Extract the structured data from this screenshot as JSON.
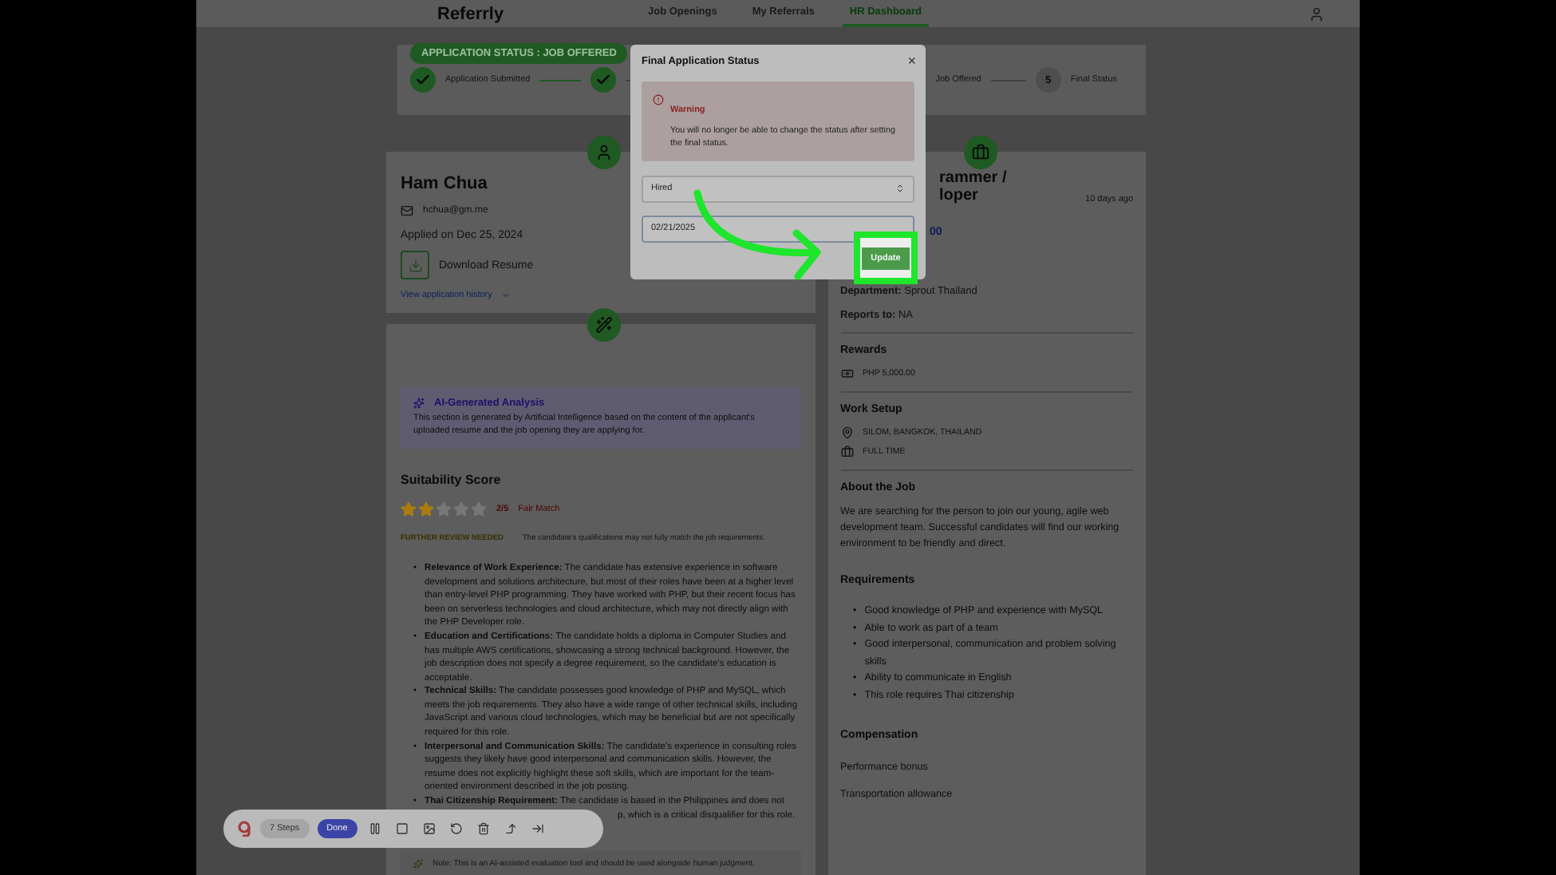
{
  "header": {
    "logo": "Referrly",
    "nav": [
      {
        "label": "Job Openings",
        "selected": false
      },
      {
        "label": "My Referrals",
        "selected": false
      },
      {
        "label": "HR Dashboard",
        "selected": true
      }
    ]
  },
  "status": {
    "badge": "APPLICATION STATUS : JOB OFFERED",
    "steps": [
      {
        "kind": "done",
        "label": "Application Submitted"
      },
      {
        "kind": "done"
      },
      {
        "kind": "text",
        "label": "Job Offered"
      },
      {
        "kind": "number",
        "number": "5",
        "label": "Final Status"
      }
    ]
  },
  "applicant": {
    "name": "Ham Chua",
    "email": "hchua@gm.me",
    "applied": "Applied on Dec 25, 2024",
    "download": "Download Resume",
    "history": "View application history"
  },
  "analysis": {
    "title": "AI-Generated Analysis",
    "description": "This section is generated by Artificial Intelligence based on the content of the applicant's uploaded resume and the job opening they are applying for.",
    "score_title": "Suitability Score",
    "stars": 2,
    "score": "2/5",
    "match": "Fair Match",
    "badge": "FURTHER REVIEW NEEDED",
    "badge_text": "The candidate's qualifications may not fully match the job requirements.",
    "bullet": "•",
    "points": [
      "**Relevance of Work Experience:** The candidate has extensive experience in software development and solutions architecture, but most of their roles have been at a higher level than entry-level PHP programming. They have worked with PHP, but their recent focus has been on serverless technologies and cloud architecture, which may not directly align with the PHP Developer role.",
      "**Education and Certifications:** The candidate holds a diploma in Computer Studies and has multiple AWS certifications, showcasing a strong technical background. However, the job description does not specify a degree requirement, so the candidate's education is acceptable.",
      "**Technical Skills:** The candidate possesses good knowledge of PHP and MySQL, which meets the job requirements. They also have a wide range of other technical skills, including JavaScript and various cloud technologies, which may be beneficial but are not specifically required for this role.",
      "**Interpersonal and Communication Skills:** The candidate's experience in consulting roles suggests they likely have good interpersonal and communication skills. However, the resume does not explicitly highlight these soft skills, which are important for the team-oriented environment described in the job posting."
    ],
    "last_point": {
      "text": "**Thai Citizenship Requirement:** The candidate is based in the Philippines and does not",
      "continued": "p, which is a critical disqualifier for this role."
    },
    "note": "Note: This is an AI-assisted evaluation tool and should be used alongside human judgment."
  },
  "job": {
    "title_lines": [
      "rammer /",
      "loper"
    ],
    "posted": "10 days ago",
    "link": "00",
    "department_label": "Department:",
    "department": "Sprout Thailand",
    "reports_label": "Reports to:",
    "reports": "NA",
    "rewards_title": "Rewards",
    "reward": "PHP 5,000.00",
    "setup_title": "Work Setup",
    "location": "SILOM, BANGKOK, THAILAND",
    "type": "FULL TIME",
    "about_title": "About the Job",
    "about": "We are searching for the person to join our young, agile web development team. Successful candidates will find our working environment to be friendly and direct.",
    "req_title": "Requirements",
    "bullet": "•",
    "requirements": [
      "Good knowledge of PHP and experience with MySQL",
      "Able to work as part of a team",
      "Good interpersonal, communication and problem solving skills",
      "Ability to communicate in English",
      "This role requires Thai citizenship"
    ],
    "comp_title": "Compensation",
    "compensation": [
      "Performance bonus",
      "Transportation allowance"
    ]
  },
  "modal": {
    "title": "Final Application Status",
    "close": "×",
    "warning_title": "Warning",
    "warning": "You will no longer be able to change the status after setting the final status.",
    "status": "Hired",
    "date": "02/21/2025",
    "button": "Update"
  },
  "recorder": {
    "steps": "7 Steps",
    "done": "Done"
  }
}
